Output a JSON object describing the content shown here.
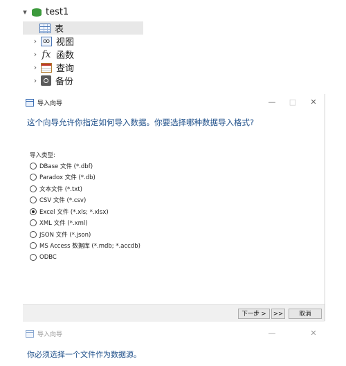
{
  "tree": {
    "db_name": "test1",
    "items": [
      {
        "label": "表"
      },
      {
        "label": "视图"
      },
      {
        "label": "函数"
      },
      {
        "label": "查询"
      },
      {
        "label": "备份"
      }
    ]
  },
  "import_wizard": {
    "title": "导入向导",
    "window_controls": {
      "minimize": "—",
      "maximize": "□",
      "close": "✕"
    },
    "heading": "这个向导允许你指定如何导入数据。你要选择哪种数据导入格式?",
    "section_label": "导入类型:",
    "options": [
      {
        "label": "DBase 文件 (*.dbf)",
        "checked": false
      },
      {
        "label": "Paradox 文件 (*.db)",
        "checked": false
      },
      {
        "label": "文本文件 (*.txt)",
        "checked": false
      },
      {
        "label": "CSV 文件 (*.csv)",
        "checked": false
      },
      {
        "label": "Excel 文件 (*.xls; *.xlsx)",
        "checked": true
      },
      {
        "label": "XML 文件 (*.xml)",
        "checked": false
      },
      {
        "label": "JSON 文件 (*.json)",
        "checked": false
      },
      {
        "label": "MS Access 数据库 (*.mdb; *.accdb)",
        "checked": false
      },
      {
        "label": "ODBC",
        "checked": false
      }
    ],
    "buttons": {
      "next": "下一步 >",
      "last": ">>",
      "cancel": "取消"
    }
  },
  "import_wizard_2": {
    "title": "导入向导",
    "window_controls": {
      "minimize": "—",
      "close": "✕"
    },
    "heading": "你必须选择一个文件作为数据源。"
  }
}
